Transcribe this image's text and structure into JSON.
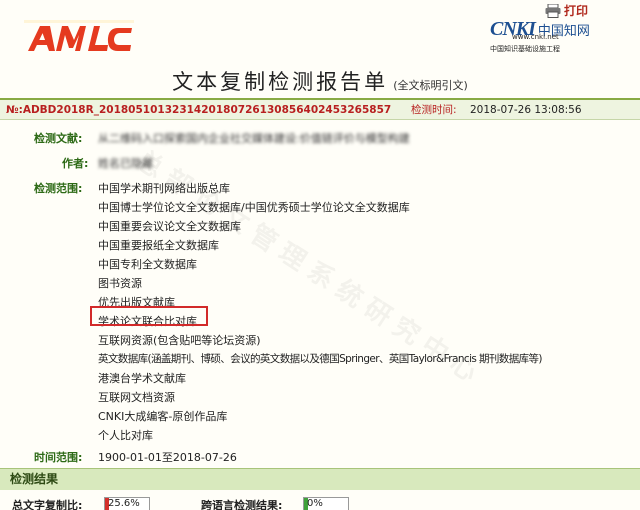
{
  "header": {
    "logo_text": "AMLC",
    "print_label": "打印",
    "cnki": {
      "brand": "CNKI",
      "cn_name": "中国知网",
      "url": "www.cnki.net",
      "subtitle": "中国知识基础设施工程"
    },
    "title": "文本复制检测报告单",
    "title_suffix": "(全文标明引文)"
  },
  "id_bar": {
    "report_id": "№:ADBD2018R_20180510132314201807261308564024532658​57",
    "time_label": "检测时间:",
    "time_value": "2018-07-26 13:08:56"
  },
  "details": {
    "document_label": "检测文献:",
    "document_value": "从二维码入口探索国内企业社交媒体建设:价值链评价与模型构建",
    "author_label": "作者:",
    "author_value": "姓名已隐藏",
    "scope_label": "检测范围:",
    "scope_items": [
      "中国学术期刊网络出版总库",
      "中国博士学位论文全文数据库/中国优秀硕士学位论文全文数据库",
      "中国重要会议论文全文数据库",
      "中国重要报纸全文数据库",
      "中国专利全文数据库",
      "图书资源",
      "优先出版文献库",
      "学术论文联合比对库",
      "互联网资源(包含贴吧等论坛资源)",
      "英文数据库(涵盖期刊、博硕、会议的英文数据以及德国Springer、英国Taylor&Francis 期刊数据库等)",
      "港澳台学术文献库",
      "互联网文档资源",
      "CNKI大成编客-原创作品库",
      "个人比对库"
    ],
    "highlighted_item": "学术论文联合比对库",
    "timerange_label": "时间范围:",
    "timerange_value": "1900-01-01至2018-07-26"
  },
  "watermark": "总部论文管理系统研究中心",
  "results": {
    "section_title": "检测结果",
    "total_label": "总文字复制比:",
    "total_value": "25.6%",
    "total_fraction": 0.256,
    "cross_label": "跨语言检测结果:",
    "cross_value": "0%",
    "cross_fraction": 0.0
  },
  "colors": {
    "label_green": "#2d6a16",
    "id_red": "#b82020",
    "highlight_border": "#d22a2a",
    "total_bar": "#d4302b",
    "cross_bar": "#3fa13a"
  }
}
